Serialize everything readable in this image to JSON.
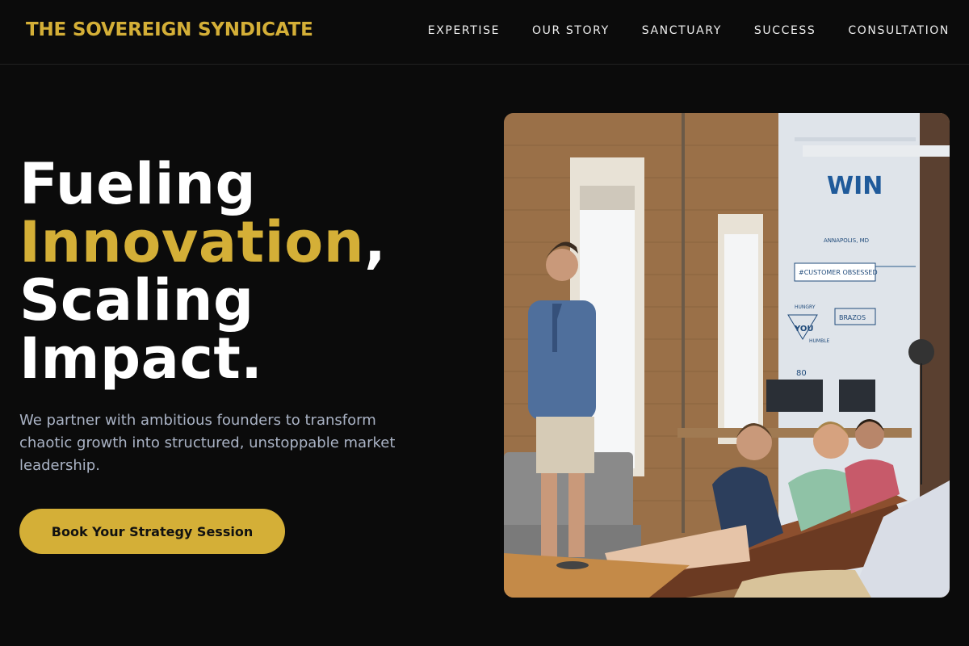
{
  "header": {
    "brand": "THE SOVEREIGN SYNDICATE",
    "nav": [
      "EXPERTISE",
      "OUR STORY",
      "SANCTUARY",
      "SUCCESS",
      "CONSULTATION"
    ]
  },
  "hero": {
    "headline": {
      "line1": "Fueling",
      "line2_accent": "Innovation",
      "line2_punct": ",",
      "line3": "Scaling",
      "line4": "Impact."
    },
    "subtext": "We partner with ambitious founders to transform chaotic growth into structured, unstoppable market leadership.",
    "cta_label": "Book Your Strategy Session",
    "photo": {
      "description_icon": "team-meeting-photo",
      "wall_text_win": "WIN",
      "wall_text_banner": "#CUSTOMER OBSESSED",
      "wall_text_city": "ANNAPOLIS, MD",
      "wall_text_hungry": "HUNGRY",
      "wall_text_you": "YOU",
      "wall_text_brazos": "BRAZOS",
      "wall_text_humble": "HUMBLE",
      "wall_text_num": "80"
    }
  },
  "colors": {
    "background": "#0b0b0b",
    "accent": "#d4af37",
    "subtext": "#aab3c5"
  }
}
